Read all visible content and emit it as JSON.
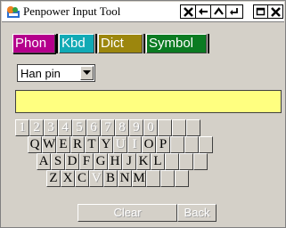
{
  "window": {
    "title": "Penpower Input Tool"
  },
  "titlebar": {
    "buttons_left": [
      "x-icon",
      "arrow-left-icon",
      "caret-up-icon",
      "enter-icon"
    ],
    "buttons_right": [
      "restore-icon",
      "close-icon"
    ]
  },
  "tabs": [
    {
      "label": "Phon",
      "color": "#b4008c",
      "active": true
    },
    {
      "label": "Kbd",
      "color": "#11aab5"
    },
    {
      "label": "Dict",
      "color": "#9c860d"
    },
    {
      "label": "Symbol",
      "color": "#0b7b22"
    }
  ],
  "method_select": {
    "value": "Han pin"
  },
  "input": {
    "value": "",
    "background": "#ffff80"
  },
  "keyboard": {
    "row1": [
      "1",
      "2",
      "3",
      "4",
      "5",
      "6",
      "7",
      "8",
      "9",
      "0",
      "",
      "",
      ""
    ],
    "row2": [
      "Q",
      "W",
      "E",
      "R",
      "T",
      "Y",
      "U",
      "I",
      "O",
      "P",
      "",
      "",
      ""
    ],
    "row3": [
      "A",
      "S",
      "D",
      "F",
      "G",
      "H",
      "J",
      "K",
      "L",
      "",
      "",
      ""
    ],
    "row4": [
      "Z",
      "X",
      "C",
      "V",
      "B",
      "N",
      "M",
      "",
      "",
      ""
    ],
    "clear_label": "Clear",
    "back_label": "Back"
  }
}
